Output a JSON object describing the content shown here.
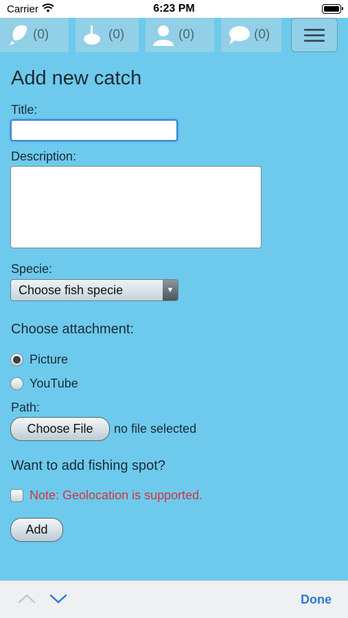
{
  "status_bar": {
    "carrier": "Carrier",
    "time": "6:23 PM"
  },
  "nav": {
    "items": [
      {
        "icon": "fish-icon",
        "count": "(0)"
      },
      {
        "icon": "fishing-float-icon",
        "count": "(0)"
      },
      {
        "icon": "user-icon",
        "count": "(0)"
      },
      {
        "icon": "comment-icon",
        "count": "(0)"
      }
    ],
    "menu_icon": "hamburger-menu-icon"
  },
  "form": {
    "title": "Add new catch",
    "title_label": "Title:",
    "title_value": "",
    "description_label": "Description:",
    "description_value": "",
    "specie_label": "Specie:",
    "specie_selected": "Choose fish specie",
    "attachment_heading": "Choose attachment:",
    "attachment_options": [
      {
        "label": "Picture",
        "checked": true
      },
      {
        "label": "YouTube",
        "checked": false
      }
    ],
    "path_label": "Path:",
    "choose_file_label": "Choose File",
    "file_status": "no file selected",
    "spot_heading": "Want to add fishing spot?",
    "geolocation_note": "Note: Geolocation is supported.",
    "add_button": "Add"
  },
  "keyboard_toolbar": {
    "done_label": "Done"
  },
  "colors": {
    "page_background": "#6dcaed",
    "note_text": "#d0363f",
    "done_text": "#2a7ad6"
  }
}
